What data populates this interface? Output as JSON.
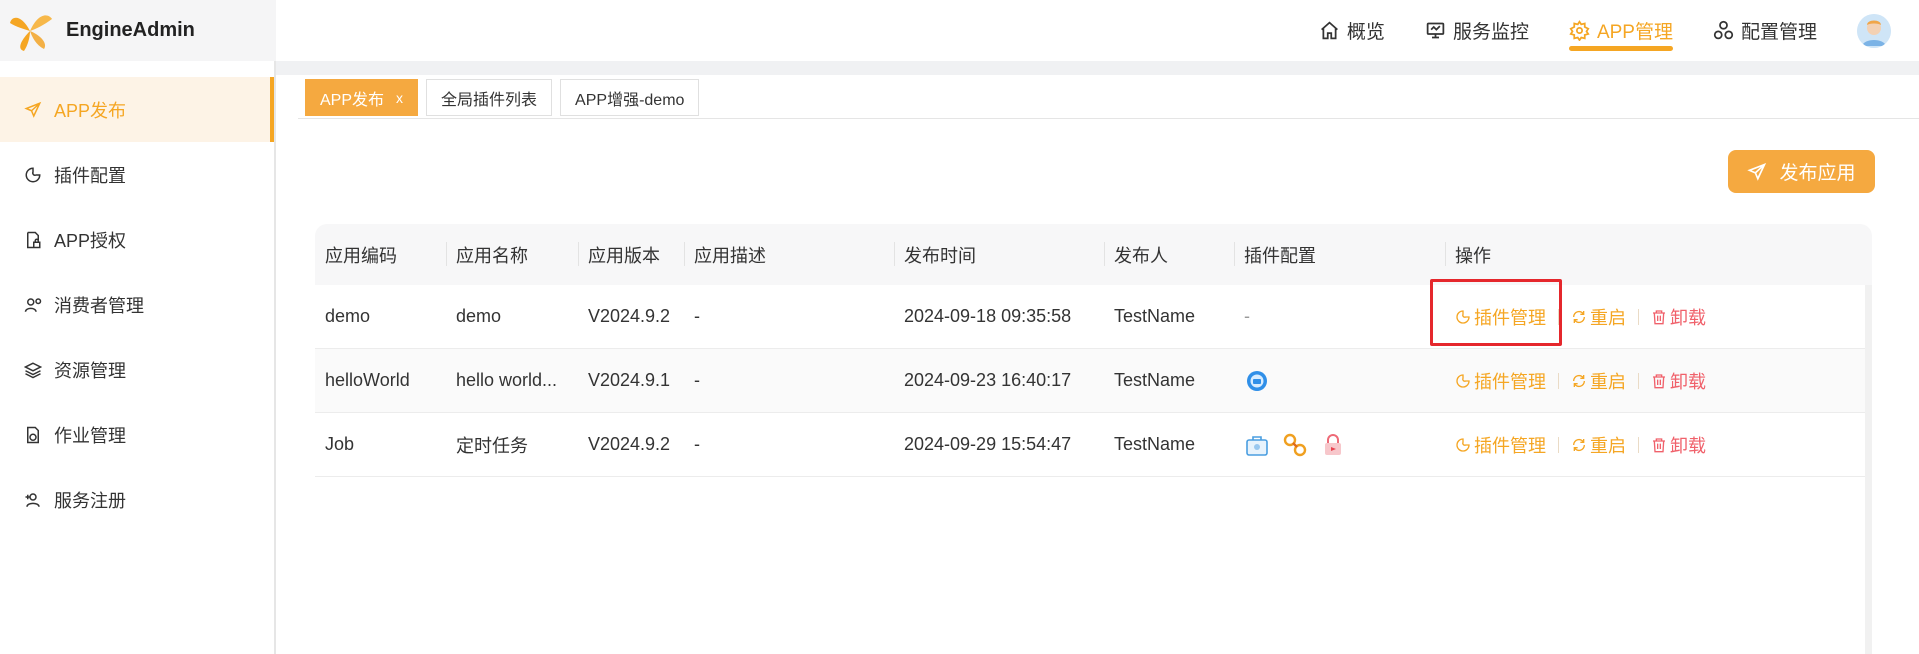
{
  "app": {
    "name": "EngineAdmin",
    "accent": "#f5a623"
  },
  "topnav": [
    {
      "label": "概览",
      "icon": "home-icon",
      "active": false
    },
    {
      "label": "服务监控",
      "icon": "monitor-icon",
      "active": false
    },
    {
      "label": "APP管理",
      "icon": "gear-icon",
      "active": true
    },
    {
      "label": "配置管理",
      "icon": "cluster-icon",
      "active": false
    }
  ],
  "sidebar": {
    "items": [
      {
        "label": "APP发布",
        "icon": "send-icon",
        "active": true
      },
      {
        "label": "插件配置",
        "icon": "puzzle-icon",
        "active": false
      },
      {
        "label": "APP授权",
        "icon": "document-lock-icon",
        "active": false
      },
      {
        "label": "消费者管理",
        "icon": "user-gear-icon",
        "active": false
      },
      {
        "label": "资源管理",
        "icon": "layers-icon",
        "active": false
      },
      {
        "label": "作业管理",
        "icon": "job-icon",
        "active": false
      },
      {
        "label": "服务注册",
        "icon": "user-add-icon",
        "active": false
      }
    ]
  },
  "tabs": [
    {
      "label": "APP发布",
      "active": true,
      "close": "x"
    },
    {
      "label": "全局插件列表",
      "active": false
    },
    {
      "label": "APP增强-demo",
      "active": false
    }
  ],
  "actions": {
    "publish_label": "发布应用"
  },
  "table": {
    "headers": [
      "应用编码",
      "应用名称",
      "应用版本",
      "应用描述",
      "发布时间",
      "发布人",
      "插件配置",
      "操作"
    ],
    "rows": [
      {
        "code": "demo",
        "name": "demo",
        "version": "V2024.9.2",
        "desc": "-",
        "time": "2024-09-18 09:35:58",
        "publisher": "TestName",
        "plugins_text": "-",
        "plugins": []
      },
      {
        "code": "helloWorld",
        "name": "hello world...",
        "version": "V2024.9.1",
        "desc": "-",
        "time": "2024-09-23 16:40:17",
        "publisher": "TestName",
        "plugins_text": "",
        "plugins": [
          "blue-badge-icon"
        ]
      },
      {
        "code": "Job",
        "name": "定时任务",
        "version": "V2024.9.2",
        "desc": "-",
        "time": "2024-09-29 15:54:47",
        "publisher": "TestName",
        "plugins_text": "",
        "plugins": [
          "toolbox-icon",
          "link-icon",
          "lock-icon"
        ]
      }
    ],
    "ops": {
      "plugin_manage": "插件管理",
      "restart": "重启",
      "uninstall": "卸载"
    }
  }
}
